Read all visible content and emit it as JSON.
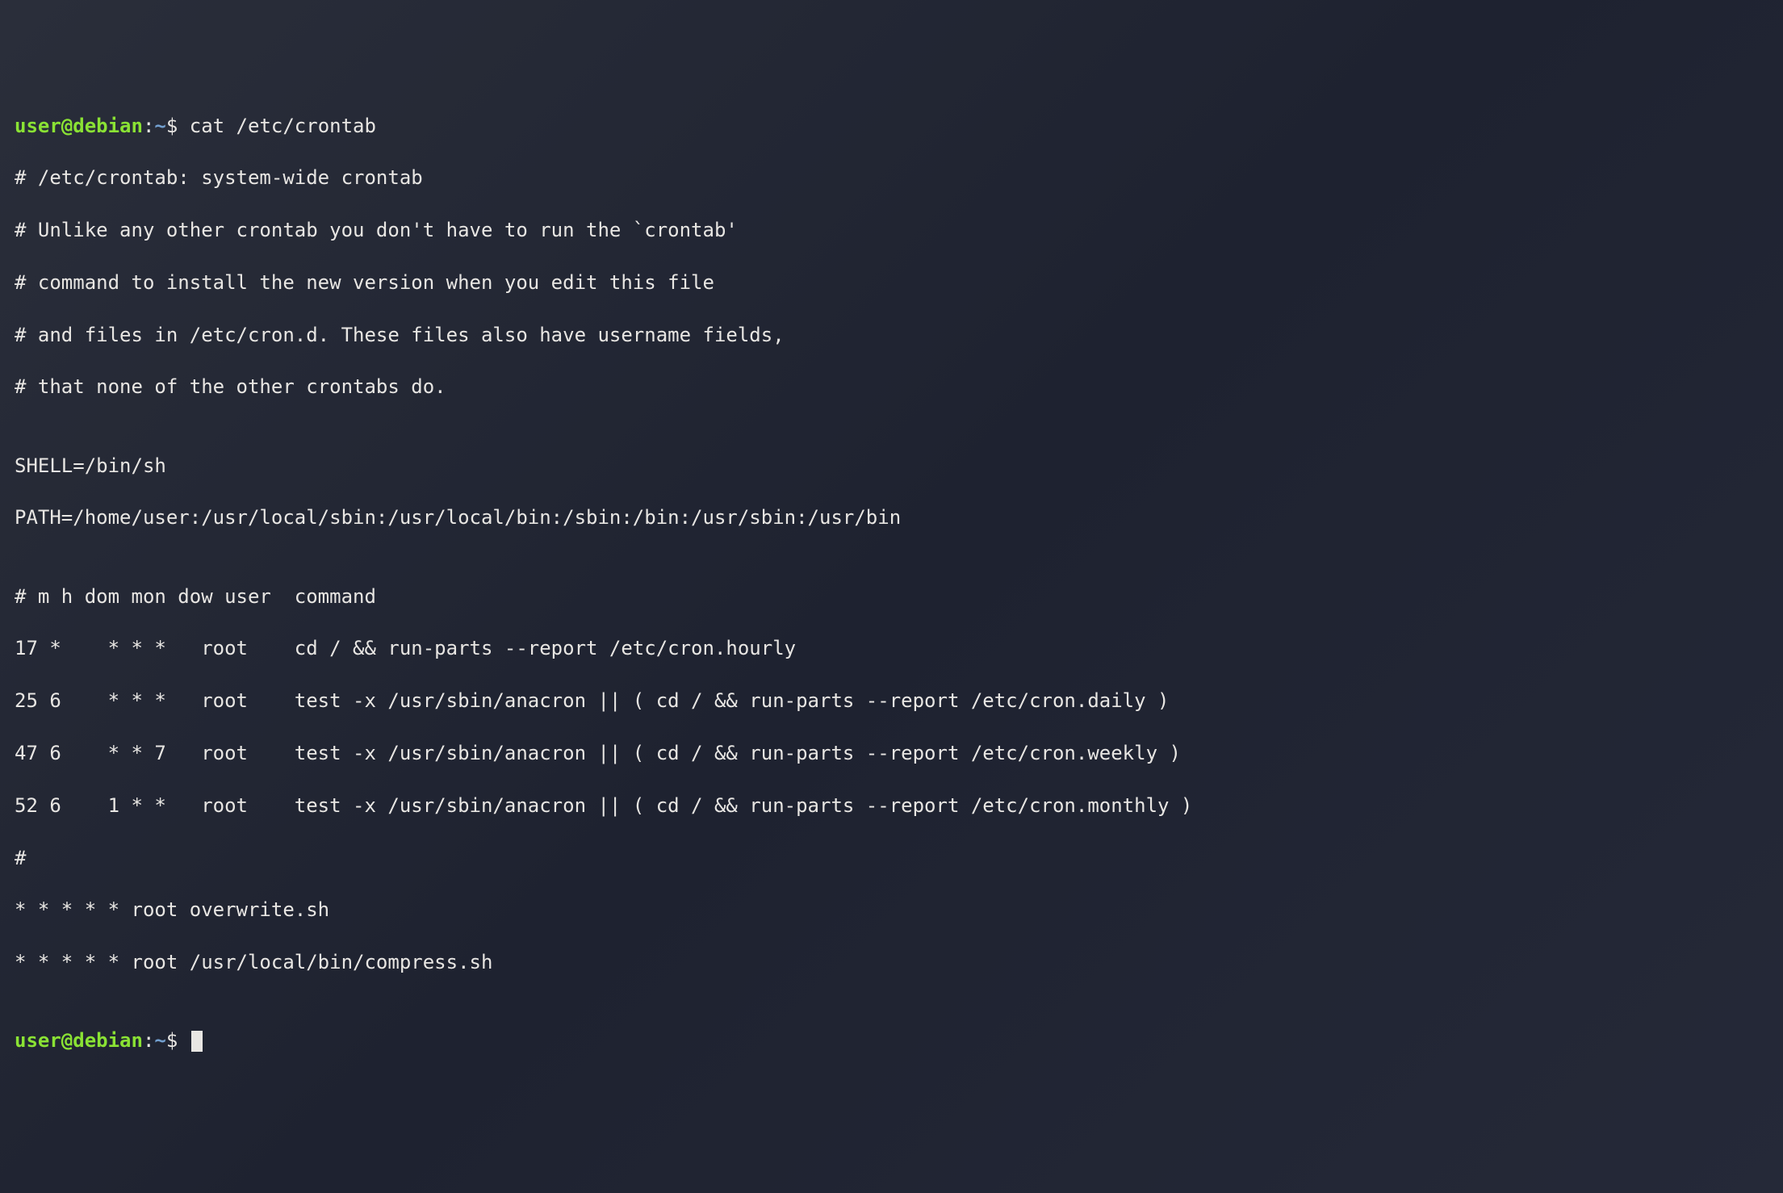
{
  "prompt1": {
    "user": "user",
    "at": "@",
    "host": "debian",
    "sep": ":",
    "path": "~",
    "dollar": "$",
    "command": " cat /etc/crontab"
  },
  "output": {
    "l1": "# /etc/crontab: system-wide crontab",
    "l2": "# Unlike any other crontab you don't have to run the `crontab'",
    "l3": "# command to install the new version when you edit this file",
    "l4": "# and files in /etc/cron.d. These files also have username fields,",
    "l5": "# that none of the other crontabs do.",
    "l6": "",
    "l7": "SHELL=/bin/sh",
    "l8": "PATH=/home/user:/usr/local/sbin:/usr/local/bin:/sbin:/bin:/usr/sbin:/usr/bin",
    "l9": "",
    "l10": "# m h dom mon dow user  command",
    "l11": "17 *    * * *   root    cd / && run-parts --report /etc/cron.hourly",
    "l12": "25 6    * * *   root    test -x /usr/sbin/anacron || ( cd / && run-parts --report /etc/cron.daily )",
    "l13": "47 6    * * 7   root    test -x /usr/sbin/anacron || ( cd / && run-parts --report /etc/cron.weekly )",
    "l14": "52 6    1 * *   root    test -x /usr/sbin/anacron || ( cd / && run-parts --report /etc/cron.monthly )",
    "l15": "#",
    "l16": "* * * * * root overwrite.sh",
    "l17": "* * * * * root /usr/local/bin/compress.sh",
    "l18": ""
  },
  "prompt2": {
    "user": "user",
    "at": "@",
    "host": "debian",
    "sep": ":",
    "path": "~",
    "dollar": "$"
  }
}
